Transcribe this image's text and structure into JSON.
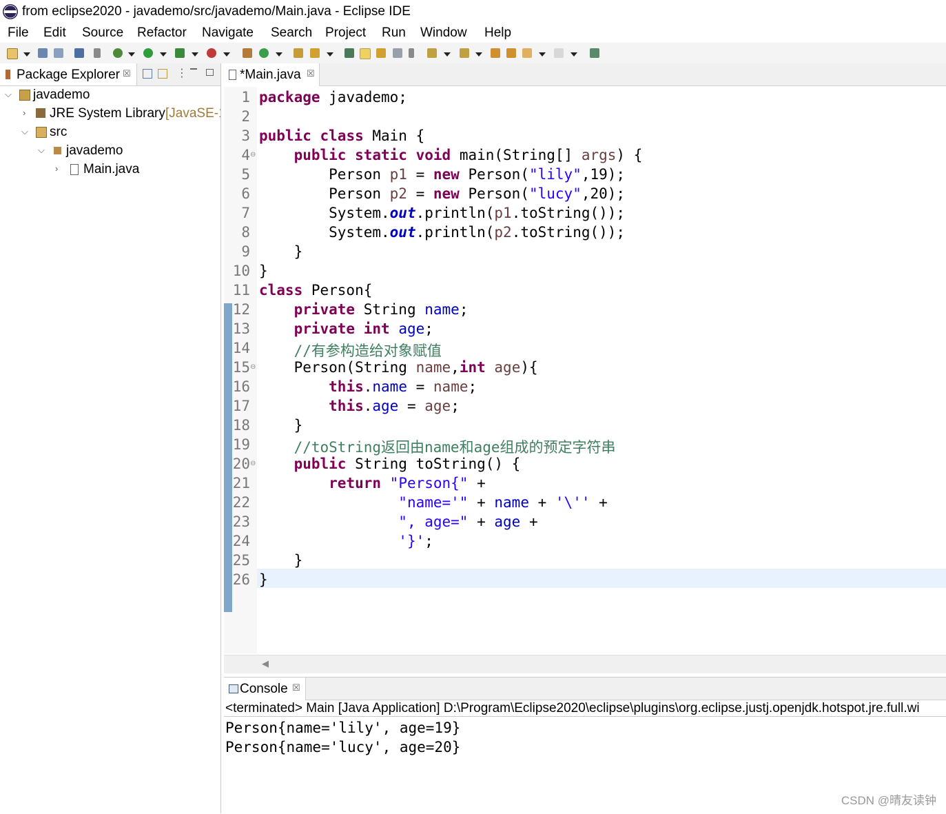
{
  "window": {
    "title": "from eclipse2020 - javademo/src/javademo/Main.java - Eclipse IDE"
  },
  "menu": [
    "File",
    "Edit",
    "Source",
    "Refactor",
    "Navigate",
    "Search",
    "Project",
    "Run",
    "Window",
    "Help"
  ],
  "package_explorer": {
    "tab_label": "Package Explorer",
    "close_glyph": "☒",
    "tree": {
      "project": "javademo",
      "jre_label": "JRE System Library",
      "jre_suffix": "[JavaSE-1",
      "src": "src",
      "package": "javademo",
      "file": "Main.java"
    }
  },
  "editor": {
    "tab_label": "*Main.java",
    "close_glyph": "☒",
    "line_numbers": [
      "1",
      "2",
      "3",
      "4",
      "5",
      "6",
      "7",
      "8",
      "9",
      "10",
      "11",
      "12",
      "13",
      "14",
      "15",
      "16",
      "17",
      "18",
      "19",
      "20",
      "21",
      "22",
      "23",
      "24",
      "25",
      "26"
    ],
    "lines": [
      [
        {
          "t": "package",
          "c": "kw"
        },
        {
          "t": " javademo;"
        }
      ],
      [],
      [
        {
          "t": "public",
          "c": "kw"
        },
        {
          "t": " "
        },
        {
          "t": "class",
          "c": "kw"
        },
        {
          "t": " Main {"
        }
      ],
      [
        {
          "t": "    "
        },
        {
          "t": "public",
          "c": "kw"
        },
        {
          "t": " "
        },
        {
          "t": "static",
          "c": "kw"
        },
        {
          "t": " "
        },
        {
          "t": "void",
          "c": "kw"
        },
        {
          "t": " main(String[] "
        },
        {
          "t": "args",
          "c": "var"
        },
        {
          "t": ") {"
        }
      ],
      [
        {
          "t": "        Person "
        },
        {
          "t": "p1",
          "c": "var"
        },
        {
          "t": " = "
        },
        {
          "t": "new",
          "c": "kw"
        },
        {
          "t": " Person("
        },
        {
          "t": "\"lily\"",
          "c": "str"
        },
        {
          "t": ",19);"
        }
      ],
      [
        {
          "t": "        Person "
        },
        {
          "t": "p2",
          "c": "var"
        },
        {
          "t": " = "
        },
        {
          "t": "new",
          "c": "kw"
        },
        {
          "t": " Person("
        },
        {
          "t": "\"lucy\"",
          "c": "str"
        },
        {
          "t": ",20);"
        }
      ],
      [
        {
          "t": "        System."
        },
        {
          "t": "out",
          "c": "sfld"
        },
        {
          "t": ".println("
        },
        {
          "t": "p1",
          "c": "var"
        },
        {
          "t": ".toString());"
        }
      ],
      [
        {
          "t": "        System."
        },
        {
          "t": "out",
          "c": "sfld"
        },
        {
          "t": ".println("
        },
        {
          "t": "p2",
          "c": "var"
        },
        {
          "t": ".toString());"
        }
      ],
      [
        {
          "t": "    }"
        }
      ],
      [
        {
          "t": "}"
        }
      ],
      [
        {
          "t": "class",
          "c": "kw"
        },
        {
          "t": " Person{"
        }
      ],
      [
        {
          "t": "    "
        },
        {
          "t": "private",
          "c": "kw"
        },
        {
          "t": " String "
        },
        {
          "t": "name",
          "c": "fld"
        },
        {
          "t": ";"
        }
      ],
      [
        {
          "t": "    "
        },
        {
          "t": "private",
          "c": "kw"
        },
        {
          "t": " "
        },
        {
          "t": "int",
          "c": "kw"
        },
        {
          "t": " "
        },
        {
          "t": "age",
          "c": "fld"
        },
        {
          "t": ";"
        }
      ],
      [
        {
          "t": "    //有参构造给对象赋值",
          "c": "cmt"
        }
      ],
      [
        {
          "t": "    Person(String "
        },
        {
          "t": "name",
          "c": "var"
        },
        {
          "t": ","
        },
        {
          "t": "int",
          "c": "kw"
        },
        {
          "t": " "
        },
        {
          "t": "age",
          "c": "var"
        },
        {
          "t": "){"
        }
      ],
      [
        {
          "t": "        "
        },
        {
          "t": "this",
          "c": "kw"
        },
        {
          "t": "."
        },
        {
          "t": "name",
          "c": "fld"
        },
        {
          "t": " = "
        },
        {
          "t": "name",
          "c": "var"
        },
        {
          "t": ";"
        }
      ],
      [
        {
          "t": "        "
        },
        {
          "t": "this",
          "c": "kw"
        },
        {
          "t": "."
        },
        {
          "t": "age",
          "c": "fld"
        },
        {
          "t": " = "
        },
        {
          "t": "age",
          "c": "var"
        },
        {
          "t": ";"
        }
      ],
      [
        {
          "t": "    }"
        }
      ],
      [
        {
          "t": "    //toString返回由name和age组成的预定字符串",
          "c": "cmt"
        }
      ],
      [
        {
          "t": "    "
        },
        {
          "t": "public",
          "c": "kw"
        },
        {
          "t": " String toString() {"
        }
      ],
      [
        {
          "t": "        "
        },
        {
          "t": "return",
          "c": "kw"
        },
        {
          "t": " "
        },
        {
          "t": "\"Person{\"",
          "c": "str"
        },
        {
          "t": " +"
        }
      ],
      [
        {
          "t": "                "
        },
        {
          "t": "\"name='\"",
          "c": "str"
        },
        {
          "t": " + "
        },
        {
          "t": "name",
          "c": "fld"
        },
        {
          "t": " + "
        },
        {
          "t": "'\\''",
          "c": "str"
        },
        {
          "t": " +"
        }
      ],
      [
        {
          "t": "                "
        },
        {
          "t": "\", age=\"",
          "c": "str"
        },
        {
          "t": " + "
        },
        {
          "t": "age",
          "c": "fld"
        },
        {
          "t": " +"
        }
      ],
      [
        {
          "t": "                "
        },
        {
          "t": "'}'",
          "c": "str"
        },
        {
          "t": ";"
        }
      ],
      [
        {
          "t": "    }"
        }
      ],
      [
        {
          "t": "}"
        }
      ]
    ]
  },
  "console": {
    "tab_label": "Console",
    "close_glyph": "☒",
    "status": "<terminated> Main [Java Application] D:\\Program\\Eclipse2020\\eclipse\\plugins\\org.eclipse.justj.openjdk.hotspot.jre.full.wi",
    "output": [
      "Person{name='lily', age=19}",
      "Person{name='lucy', age=20}"
    ]
  },
  "watermark": "CSDN @晴友读钟"
}
